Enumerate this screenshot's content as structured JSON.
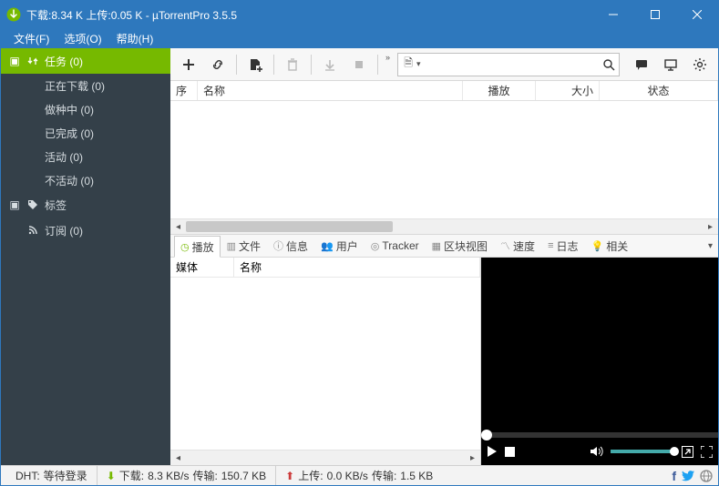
{
  "titlebar": {
    "title": "下载:8.34 K 上传:0.05 K - µTorrentPro 3.5.5"
  },
  "menubar": {
    "file": "文件(F)",
    "options": "选项(O)",
    "help": "帮助(H)"
  },
  "sidebar": {
    "tasks_label": "任务 (0)",
    "downloading": "正在下载 (0)",
    "seeding": "做种中 (0)",
    "completed": "已完成 (0)",
    "active": "活动 (0)",
    "inactive": "不活动 (0)",
    "tags_label": "标签",
    "feeds_label": "订阅 (0)"
  },
  "search": {
    "placeholder": ""
  },
  "columns": {
    "index": "序",
    "name": "名称",
    "play": "播放",
    "size": "大小",
    "status": "状态"
  },
  "tabs": {
    "play": "播放",
    "files": "文件",
    "info": "信息",
    "users": "用户",
    "tracker": "Tracker",
    "pieces": "区块视图",
    "speed": "速度",
    "log": "日志",
    "related": "相关"
  },
  "detail_cols": {
    "media": "媒体",
    "name": "名称"
  },
  "status": {
    "dht_label": "DHT:",
    "dht_value": "等待登录",
    "down_label": "下载:",
    "down_speed": "8.3 KB/s",
    "down_xfer_label": "传输:",
    "down_xfer": "150.7 KB",
    "up_label": "上传:",
    "up_speed": "0.0 KB/s",
    "up_xfer_label": "传输:",
    "up_xfer": "1.5 KB"
  }
}
